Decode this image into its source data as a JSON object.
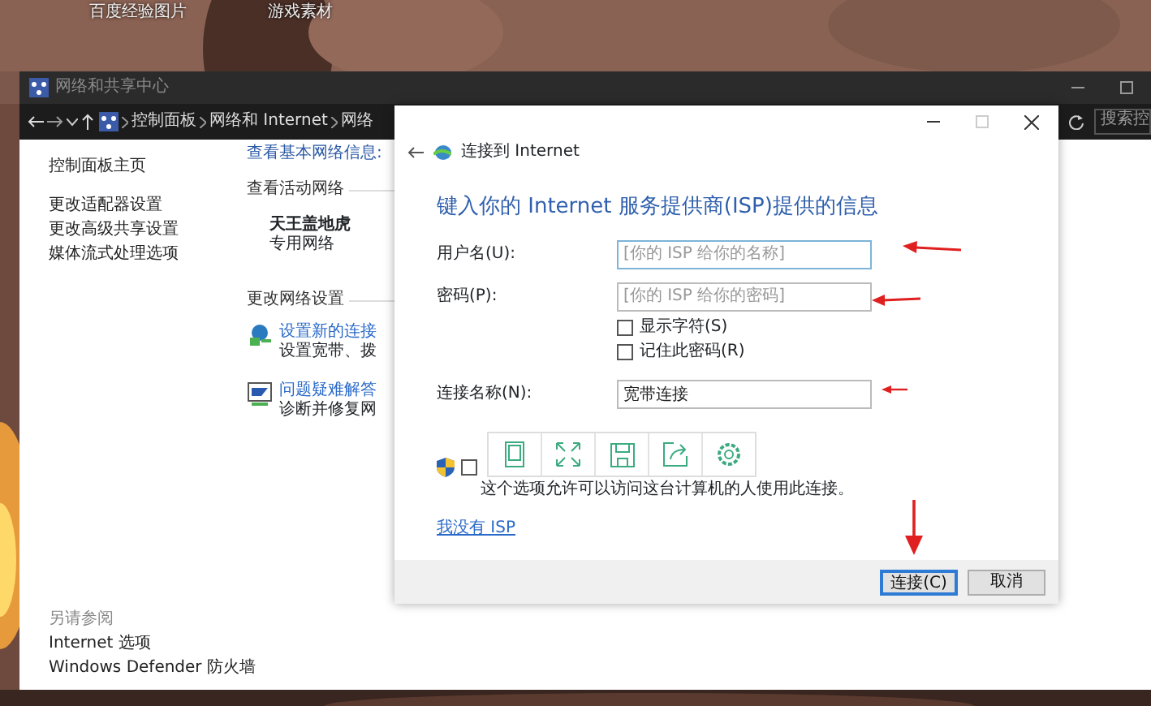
{
  "desktop": {
    "icons": [
      {
        "label": "百度经验图片"
      },
      {
        "label": "游戏素材"
      }
    ]
  },
  "network_window": {
    "title": "网络和共享中心",
    "breadcrumb": [
      "控制面板",
      "网络和 Internet",
      "网络"
    ],
    "search_placeholder": "搜索控",
    "sidebar": {
      "links": [
        "控制面板主页",
        "更改适配器设置",
        "更改高级共享设置",
        "媒体流式处理选项"
      ],
      "see_also_title": "另请参阅",
      "see_also": [
        "Internet 选项",
        "Windows Defender 防火墙"
      ]
    },
    "main": {
      "heading": "查看基本网络信息:",
      "active_networks_title": "查看活动网络",
      "network_name": "天王盖地虎",
      "network_type": "专用网络",
      "change_settings_title": "更改网络设置",
      "tasks": [
        {
          "kind": "connect",
          "link": "设置新的连接",
          "description": "设置宽带、拨"
        },
        {
          "kind": "troubleshoot",
          "link": "问题疑难解答",
          "description": "诊断并修复网"
        }
      ]
    }
  },
  "dialog": {
    "title": "连接到 Internet",
    "heading": "键入你的 Internet 服务提供商(ISP)提供的信息",
    "fields": [
      {
        "label": "用户名(U):",
        "placeholder": "[你的 ISP 给你的名称]",
        "focused": true
      },
      {
        "label": "密码(P):",
        "placeholder": "[你的 ISP 给你的密码]",
        "focused": false
      }
    ],
    "checkboxes": [
      {
        "label": "显示字符(S)",
        "checked": false
      },
      {
        "label": "记住此密码(R)",
        "checked": false
      }
    ],
    "name_field": {
      "label": "连接名称(N):",
      "value": "宽带连接",
      "focused": false
    },
    "share": {
      "checked": false,
      "description": "这个选项允许可以访问这台计算机的人使用此连接。"
    },
    "link": "我没有 ISP",
    "buttons": [
      {
        "label": "连接(C)",
        "default": true
      },
      {
        "label": "取消",
        "default": false
      }
    ]
  }
}
